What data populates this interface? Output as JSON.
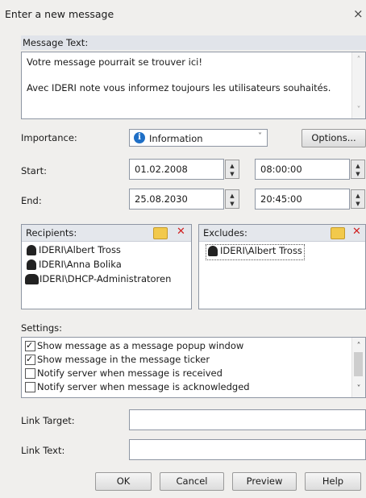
{
  "dialog": {
    "title": "Enter a new message",
    "close": "×"
  },
  "message": {
    "label": "Message Text:",
    "lines": [
      "Votre message pourrait se trouver ici!",
      "",
      "Avec IDERI note vous informez toujours les utilisateurs souhaités."
    ]
  },
  "importance": {
    "label": "Importance:",
    "value": "Information",
    "icon": "info-icon",
    "options_label": "Options..."
  },
  "start": {
    "label": "Start:",
    "date": "01.02.2008",
    "time": "08:00:00"
  },
  "end": {
    "label": "End:",
    "date": "25.08.2030",
    "time": "20:45:00"
  },
  "recipients": {
    "label": "Recipients:",
    "items": [
      "IDERI\\Albert Tross",
      "IDERI\\Anna Bolika",
      "IDERI\\DHCP-Administratoren"
    ]
  },
  "excludes": {
    "label": "Excludes:",
    "items": [
      "IDERI\\Albert Tross"
    ]
  },
  "settings": {
    "label": "Settings:",
    "items": [
      {
        "label": "Show message as a message popup window",
        "checked": true
      },
      {
        "label": "Show message in the message ticker",
        "checked": true
      },
      {
        "label": "Notify server when message is received",
        "checked": false
      },
      {
        "label": "Notify server when message is acknowledged",
        "checked": false
      }
    ]
  },
  "link_target": {
    "label": "Link Target:",
    "value": ""
  },
  "link_text": {
    "label": "Link Text:",
    "value": ""
  },
  "buttons": {
    "ok": "OK",
    "cancel": "Cancel",
    "preview": "Preview",
    "help": "Help"
  }
}
